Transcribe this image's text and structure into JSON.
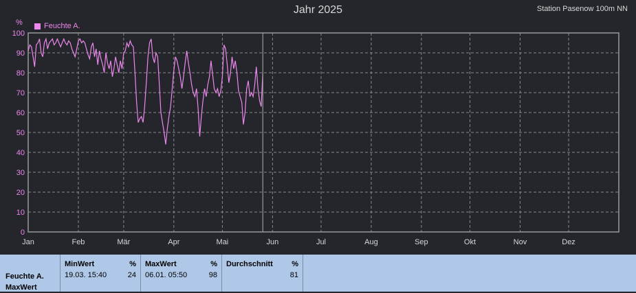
{
  "header": {
    "title": "Jahr 2025",
    "station": "Station Pasenow 100m NN"
  },
  "chart_data": {
    "type": "line",
    "title": "Jahr 2025",
    "ylabel": "%",
    "ylim": [
      0,
      100
    ],
    "yticks": [
      0,
      10,
      20,
      30,
      40,
      50,
      60,
      70,
      80,
      90,
      100
    ],
    "x_tick_labels": [
      "Jan",
      "Feb",
      "Mär",
      "Apr",
      "Mai",
      "Jun",
      "Jul",
      "Aug",
      "Sep",
      "Okt",
      "Nov",
      "Dez"
    ],
    "grid": true,
    "legend_position": "top-left",
    "colors": {
      "series": "#ee88ee",
      "background": "#24262b",
      "grid": "#8a8a8a",
      "axis_text": "#ee88ee",
      "xaxis_text": "#d8d8d8"
    },
    "series": [
      {
        "name": "Feuchte A.",
        "x_unit": "day of year",
        "values": [
          91,
          94,
          93,
          88,
          83,
          94,
          95,
          97,
          90,
          88,
          95,
          97,
          92,
          95,
          96,
          97,
          94,
          95,
          97,
          95,
          93,
          95,
          97,
          95,
          94,
          96,
          95,
          92,
          90,
          88,
          92,
          96,
          97,
          95,
          96,
          95,
          92,
          89,
          87,
          93,
          95,
          88,
          92,
          84,
          91,
          87,
          84,
          80,
          90,
          85,
          82,
          86,
          78,
          82,
          88,
          84,
          80,
          86,
          82,
          90,
          91,
          95,
          93,
          96,
          94,
          93,
          80,
          65,
          55,
          57,
          58,
          55,
          63,
          75,
          88,
          95,
          97,
          88,
          85,
          90,
          88,
          75,
          60,
          55,
          50,
          44,
          52,
          58,
          63,
          72,
          81,
          88,
          86,
          82,
          78,
          72,
          78,
          85,
          91,
          85,
          80,
          74,
          70,
          68,
          72,
          62,
          48,
          58,
          66,
          72,
          68,
          74,
          78,
          86,
          79,
          72,
          70,
          72,
          68,
          71,
          78,
          94,
          92,
          84,
          75,
          80,
          88,
          82,
          86,
          80,
          71,
          68,
          65,
          54,
          60,
          72,
          76,
          68,
          70,
          68,
          74,
          83,
          72,
          66,
          63,
          80
        ]
      }
    ]
  },
  "stats": {
    "row_label_line1": "Feuchte A.",
    "row_label_line2": "MaxWert",
    "min": {
      "label": "MinWert",
      "unit": "%",
      "date": "19.03.  15:40",
      "value": "24"
    },
    "max": {
      "label": "MaxWert",
      "unit": "%",
      "date": "06.01.  05:50",
      "value": "98"
    },
    "avg": {
      "label": "Durchschnitt",
      "unit": "%",
      "value": "81"
    }
  }
}
